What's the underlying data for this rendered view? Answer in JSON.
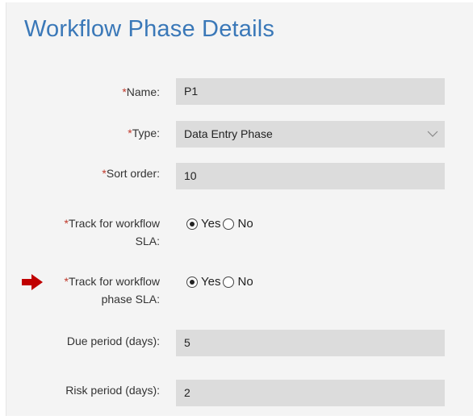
{
  "title": "Workflow Phase Details",
  "required_marker": "*",
  "fields": {
    "name": {
      "label": "Name:",
      "value": "P1"
    },
    "type": {
      "label": "Type:",
      "value": "Data Entry Phase"
    },
    "sort_order": {
      "label": "Sort order:",
      "value": "10"
    },
    "track_sla": {
      "label_line1": "Track for workflow",
      "label_line2": "SLA:",
      "yes": "Yes",
      "no": "No",
      "selected": "Yes"
    },
    "track_phase_sla": {
      "label_line1": "Track for workflow",
      "label_line2": "phase SLA:",
      "yes": "Yes",
      "no": "No",
      "selected": "Yes"
    },
    "due_period": {
      "label": "Due period (days):",
      "value": "5"
    },
    "risk_period": {
      "label": "Risk period (days):",
      "value": "2"
    }
  },
  "icons": {
    "indicator": "red-arrow-icon",
    "dropdown": "chevron-down-icon"
  },
  "colors": {
    "title": "#3a78b8",
    "required": "#c0392b",
    "arrow": "#c00000",
    "field_bg": "#dcdcdc",
    "panel_bg": "#f4f4f4"
  }
}
